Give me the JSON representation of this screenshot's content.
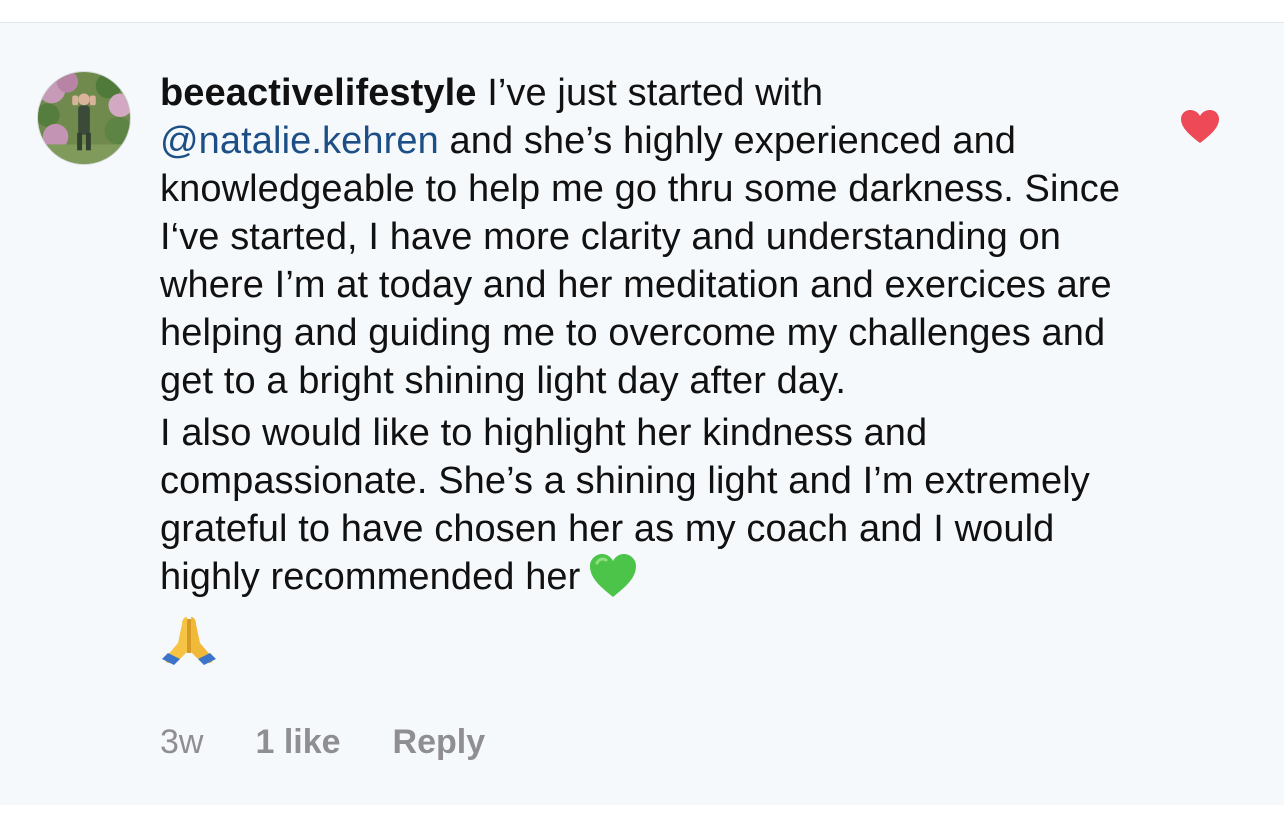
{
  "comment": {
    "username": "beeactivelifestyle",
    "text_intro": "I’ve just started with",
    "mention": "@natalie.kehren",
    "text_part1": " and she’s highly experienced and knowledgeable to help me go thru some darkness. Since I‘ve started, I have more clarity and understanding on where I’m at today and her meditation and exercices are helping and guiding me to overcome my challenges and get to a bright shining light day after day.",
    "text_part2": "I also would like to highlight her kindness and compassionate. She’s a shining light and I’m extremely grateful to have chosen her as my coach and I would highly recommended her",
    "emojis": [
      "green-heart-emoji",
      "folded-hands-emoji"
    ],
    "liked": true
  },
  "meta": {
    "time": "3w",
    "likes": "1 like",
    "reply": "Reply"
  },
  "colors": {
    "background": "#f6f9fc",
    "mention": "#1d4f87",
    "heart": "#ed4956",
    "meta": "#8e8e93"
  }
}
